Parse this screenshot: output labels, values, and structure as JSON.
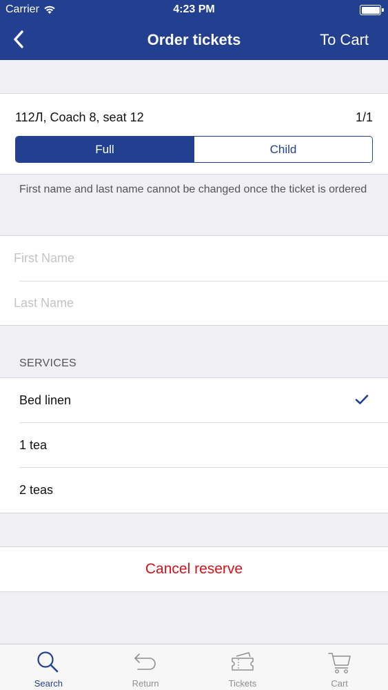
{
  "status_bar": {
    "carrier": "Carrier",
    "time": "4:23 PM"
  },
  "nav": {
    "title": "Order tickets",
    "right_action": "To Cart"
  },
  "ticket": {
    "info": "112Л, Coach 8, seat 12",
    "count": "1/1",
    "segments": [
      {
        "label": "Full",
        "selected": true
      },
      {
        "label": "Child",
        "selected": false
      }
    ]
  },
  "notice": "First name and last name cannot be changed once the ticket is ordered",
  "name_fields": {
    "first_name": {
      "value": "",
      "placeholder": "First Name"
    },
    "last_name": {
      "value": "",
      "placeholder": "Last Name"
    }
  },
  "services": {
    "header": "SERVICES",
    "items": [
      {
        "label": "Bed linen",
        "checked": true
      },
      {
        "label": "1 tea",
        "checked": false
      },
      {
        "label": "2 teas",
        "checked": false
      }
    ]
  },
  "cancel": {
    "label": "Cancel reserve"
  },
  "tab_bar": {
    "items": [
      {
        "label": "Search",
        "icon": "search-icon",
        "active": true
      },
      {
        "label": "Return",
        "icon": "return-icon",
        "active": false
      },
      {
        "label": "Tickets",
        "icon": "tickets-icon",
        "active": false
      },
      {
        "label": "Cart",
        "icon": "cart-icon",
        "active": false
      }
    ]
  },
  "colors": {
    "brand": "#233f8f",
    "destructive": "#d0121a",
    "background": "#efeff4"
  }
}
